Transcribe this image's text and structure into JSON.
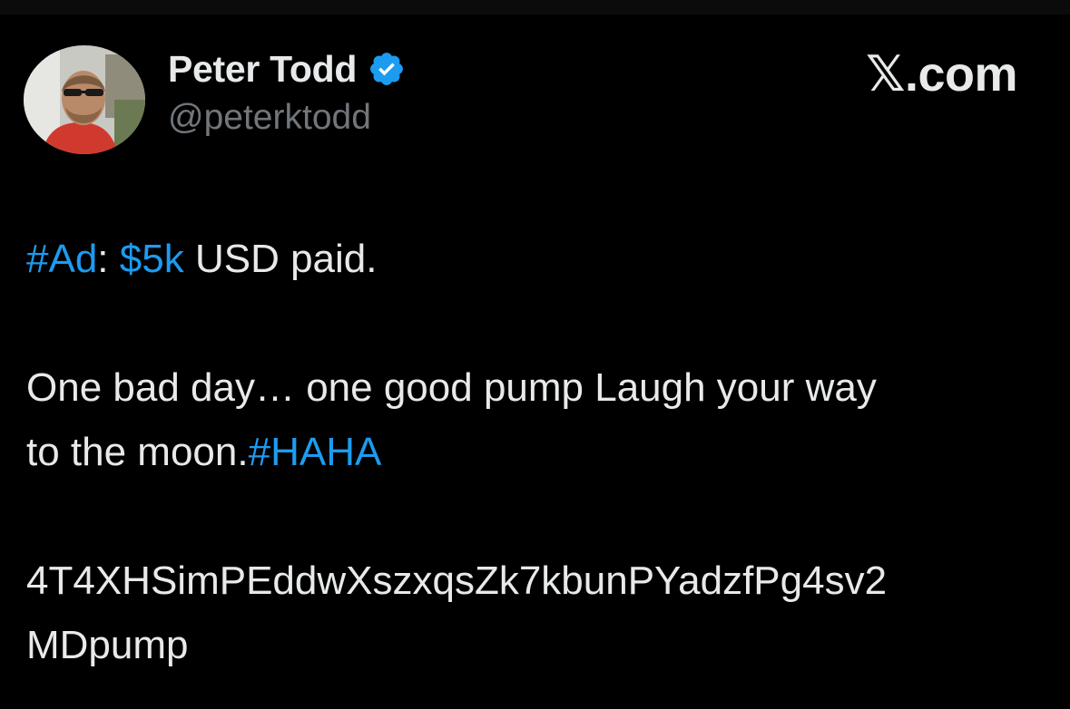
{
  "tweet": {
    "author": {
      "display_name": "Peter Todd",
      "handle": "@peterktodd",
      "verified": true,
      "verified_color": "#1d9bf0"
    },
    "brand": "𝕏.com",
    "body": {
      "line1": {
        "hashtag_ad": "#Ad",
        "colon": ":",
        "amount": "$5k",
        "rest": "USD paid."
      },
      "line2": "One bad day… one good pump  Laugh your way",
      "line3": {
        "text": "to the moon.",
        "hashtag": "#HAHA"
      },
      "address_part1": "4T4XHSimPEddwXszxqsZk7kbunPYadzfPg4sv2",
      "address_part2": "MDpump"
    }
  },
  "colors": {
    "background": "#000000",
    "text": "#e7e9ea",
    "secondary_text": "#71767b",
    "link": "#1d9bf0"
  },
  "icons": {
    "avatar": "profile-photo",
    "verified": "verified-badge-icon"
  }
}
